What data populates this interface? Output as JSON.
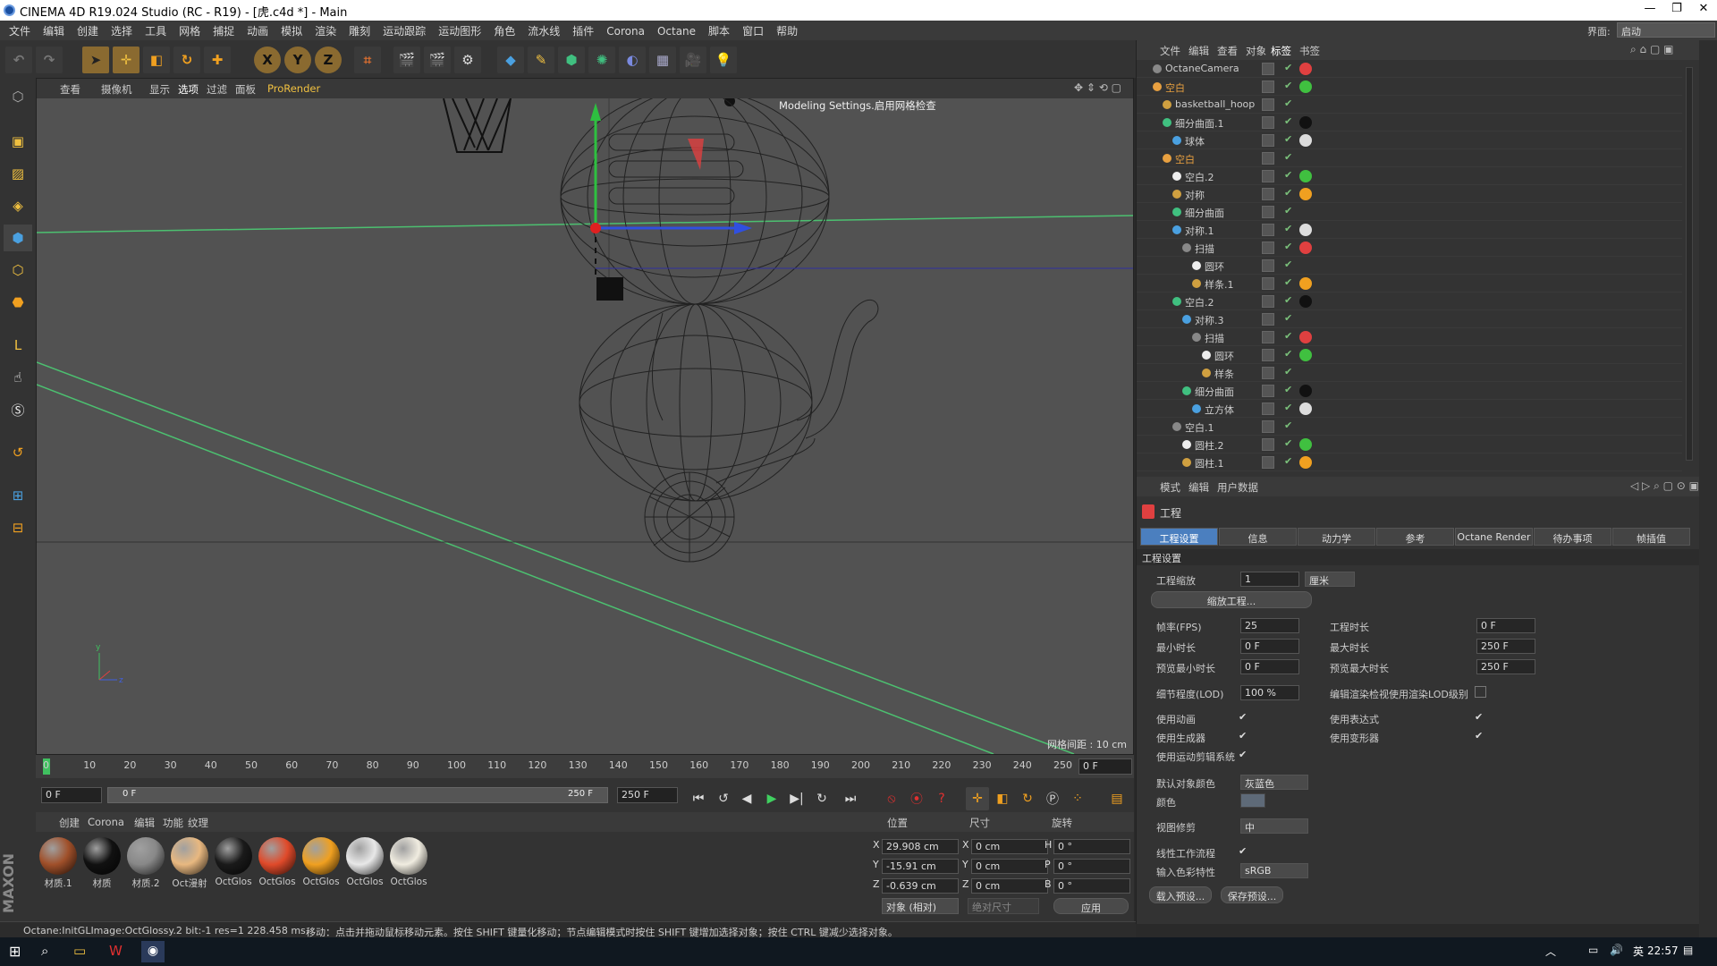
{
  "window": {
    "title": "CINEMA 4D R19.024 Studio (RC - R19) - [虎.c4d *] - Main"
  },
  "menu": [
    "文件",
    "编辑",
    "创建",
    "选择",
    "工具",
    "网格",
    "捕捉",
    "动画",
    "模拟",
    "渲染",
    "雕刻",
    "运动跟踪",
    "运动图形",
    "角色",
    "流水线",
    "插件",
    "Corona",
    "Octane",
    "脚本",
    "窗口",
    "帮助"
  ],
  "layout": {
    "label": "界面:",
    "value": "启动"
  },
  "viewport": {
    "menu": [
      "查看",
      "摄像机",
      "显示",
      "选项",
      "过滤",
      "面板",
      "ProRender"
    ],
    "overlay_text": "Modeling Settings.启用网格检查",
    "grid_spacing": "网格间距 : 10 cm"
  },
  "timeline": {
    "ticks": [
      "0",
      "10",
      "20",
      "30",
      "40",
      "50",
      "60",
      "70",
      "80",
      "90",
      "100",
      "110",
      "120",
      "130",
      "140",
      "150",
      "160",
      "170",
      "180",
      "190",
      "200",
      "210",
      "220",
      "230",
      "240",
      "250"
    ],
    "current_frame": "0 F",
    "start": "0 F",
    "range_start": "0 F",
    "range_end": "250 F",
    "end": "250 F"
  },
  "materials": {
    "menu": [
      "创建",
      "Corona",
      "编辑",
      "功能",
      "纹理"
    ],
    "items": [
      {
        "label": "材质.1",
        "color": "#a0502a"
      },
      {
        "label": "材质",
        "color": "#111111"
      },
      {
        "label": "材质.2",
        "color": "#888888"
      },
      {
        "label": "Oct漫射",
        "color": "#e8b880"
      },
      {
        "label": "OctGlos",
        "color": "#1a1a1a"
      },
      {
        "label": "OctGlos",
        "color": "#e04a2a"
      },
      {
        "label": "OctGlos",
        "color": "#f0a020"
      },
      {
        "label": "OctGlos",
        "color": "#e8e8e8"
      },
      {
        "label": "OctGlos",
        "color": "#f0ece0"
      }
    ]
  },
  "coords": {
    "headers": [
      "位置",
      "尺寸",
      "旋转"
    ],
    "rows": [
      {
        "axis": "X",
        "pos": "29.908 cm",
        "size_axis": "X",
        "size": "0 cm",
        "rot_axis": "H",
        "rot": "0 °"
      },
      {
        "axis": "Y",
        "pos": "-15.91 cm",
        "size_axis": "Y",
        "size": "0 cm",
        "rot_axis": "P",
        "rot": "0 °"
      },
      {
        "axis": "Z",
        "pos": "-0.639 cm",
        "size_axis": "Z",
        "size": "0 cm",
        "rot_axis": "B",
        "rot": "0 °"
      }
    ],
    "mode": "对象 (相对)",
    "size_mode": "绝对尺寸",
    "apply": "应用"
  },
  "status": {
    "left": "Octane:InitGLImage:OctGlossy.2  bit:-1 res=1  228.458 ms.",
    "hint": "移动：点击并拖动鼠标移动元素。按住 SHIFT 键量化移动；节点编辑模式时按住 SHIFT 键增加选择对象；按住 CTRL 键减少选择对象。"
  },
  "objects": {
    "menu": [
      "文件",
      "编辑",
      "查看",
      "对象",
      "标签",
      "书签"
    ],
    "rows": [
      {
        "name": "OctaneCamera",
        "indent": 0,
        "highlight": false
      },
      {
        "name": "空白",
        "indent": 0,
        "highlight": true
      },
      {
        "name": "basketball_hoop",
        "indent": 1,
        "highlight": false
      },
      {
        "name": "细分曲面.1",
        "indent": 1,
        "highlight": false
      },
      {
        "name": "球体",
        "indent": 2,
        "highlight": false
      },
      {
        "name": "空白",
        "indent": 1,
        "highlight": true
      },
      {
        "name": "空白.2",
        "indent": 2,
        "highlight": false
      },
      {
        "name": "对称",
        "indent": 2,
        "highlight": false
      },
      {
        "name": "细分曲面",
        "indent": 2,
        "highlight": false
      },
      {
        "name": "对称.1",
        "indent": 2,
        "highlight": false
      },
      {
        "name": "扫描",
        "indent": 3,
        "highlight": false
      },
      {
        "name": "圆环",
        "indent": 4,
        "highlight": false
      },
      {
        "name": "样条.1",
        "indent": 4,
        "highlight": false
      },
      {
        "name": "空白.2",
        "indent": 2,
        "highlight": false
      },
      {
        "name": "对称.3",
        "indent": 3,
        "highlight": false
      },
      {
        "name": "扫描",
        "indent": 4,
        "highlight": false
      },
      {
        "name": "圆环",
        "indent": 5,
        "highlight": false
      },
      {
        "name": "样条",
        "indent": 5,
        "highlight": false
      },
      {
        "name": "细分曲面",
        "indent": 3,
        "highlight": false
      },
      {
        "name": "立方体",
        "indent": 4,
        "highlight": false
      },
      {
        "name": "空白.1",
        "indent": 2,
        "highlight": false
      },
      {
        "name": "圆柱.2",
        "indent": 3,
        "highlight": false
      },
      {
        "name": "圆柱.1",
        "indent": 3,
        "highlight": false
      }
    ]
  },
  "attributes": {
    "menu": [
      "模式",
      "编辑",
      "用户数据"
    ],
    "title": "工程",
    "tabs": [
      "工程设置",
      "信息",
      "动力学",
      "参考",
      "Octane Render",
      "待办事项",
      "帧插值"
    ],
    "section": "工程设置",
    "scale_label": "工程缩放",
    "scale_value": "1",
    "scale_unit": "厘米",
    "scale_button": "缩放工程...",
    "fps_label": "帧率(FPS)",
    "fps_value": "25",
    "project_time_label": "工程时长",
    "project_time_value": "0 F",
    "min_time_label": "最小时长",
    "min_time_value": "0 F",
    "max_time_label": "最大时长",
    "max_time_value": "250 F",
    "preview_min_label": "预览最小时长",
    "preview_min_value": "0 F",
    "preview_max_label": "预览最大时长",
    "preview_max_value": "250 F",
    "lod_label": "细节程度(LOD)",
    "lod_value": "100 %",
    "lod_render_label": "编辑渲染检视使用渲染LOD级别",
    "use_anim_label": "使用动画",
    "use_expr_label": "使用表达式",
    "use_gen_label": "使用生成器",
    "use_deform_label": "使用变形器",
    "use_mograph_label": "使用运动剪辑系统",
    "default_color_label": "默认对象颜色",
    "default_color_value": "灰蓝色",
    "color_label": "颜色",
    "view_clip_label": "视图修剪",
    "view_clip_value": "中",
    "linear_label": "线性工作流程",
    "input_color_label": "输入色彩特性",
    "input_color_value": "sRGB",
    "load_preset": "载入预设...",
    "save_preset": "保存预设..."
  },
  "taskbar": {
    "time": "22:57"
  },
  "accent": "#4b7fbf"
}
